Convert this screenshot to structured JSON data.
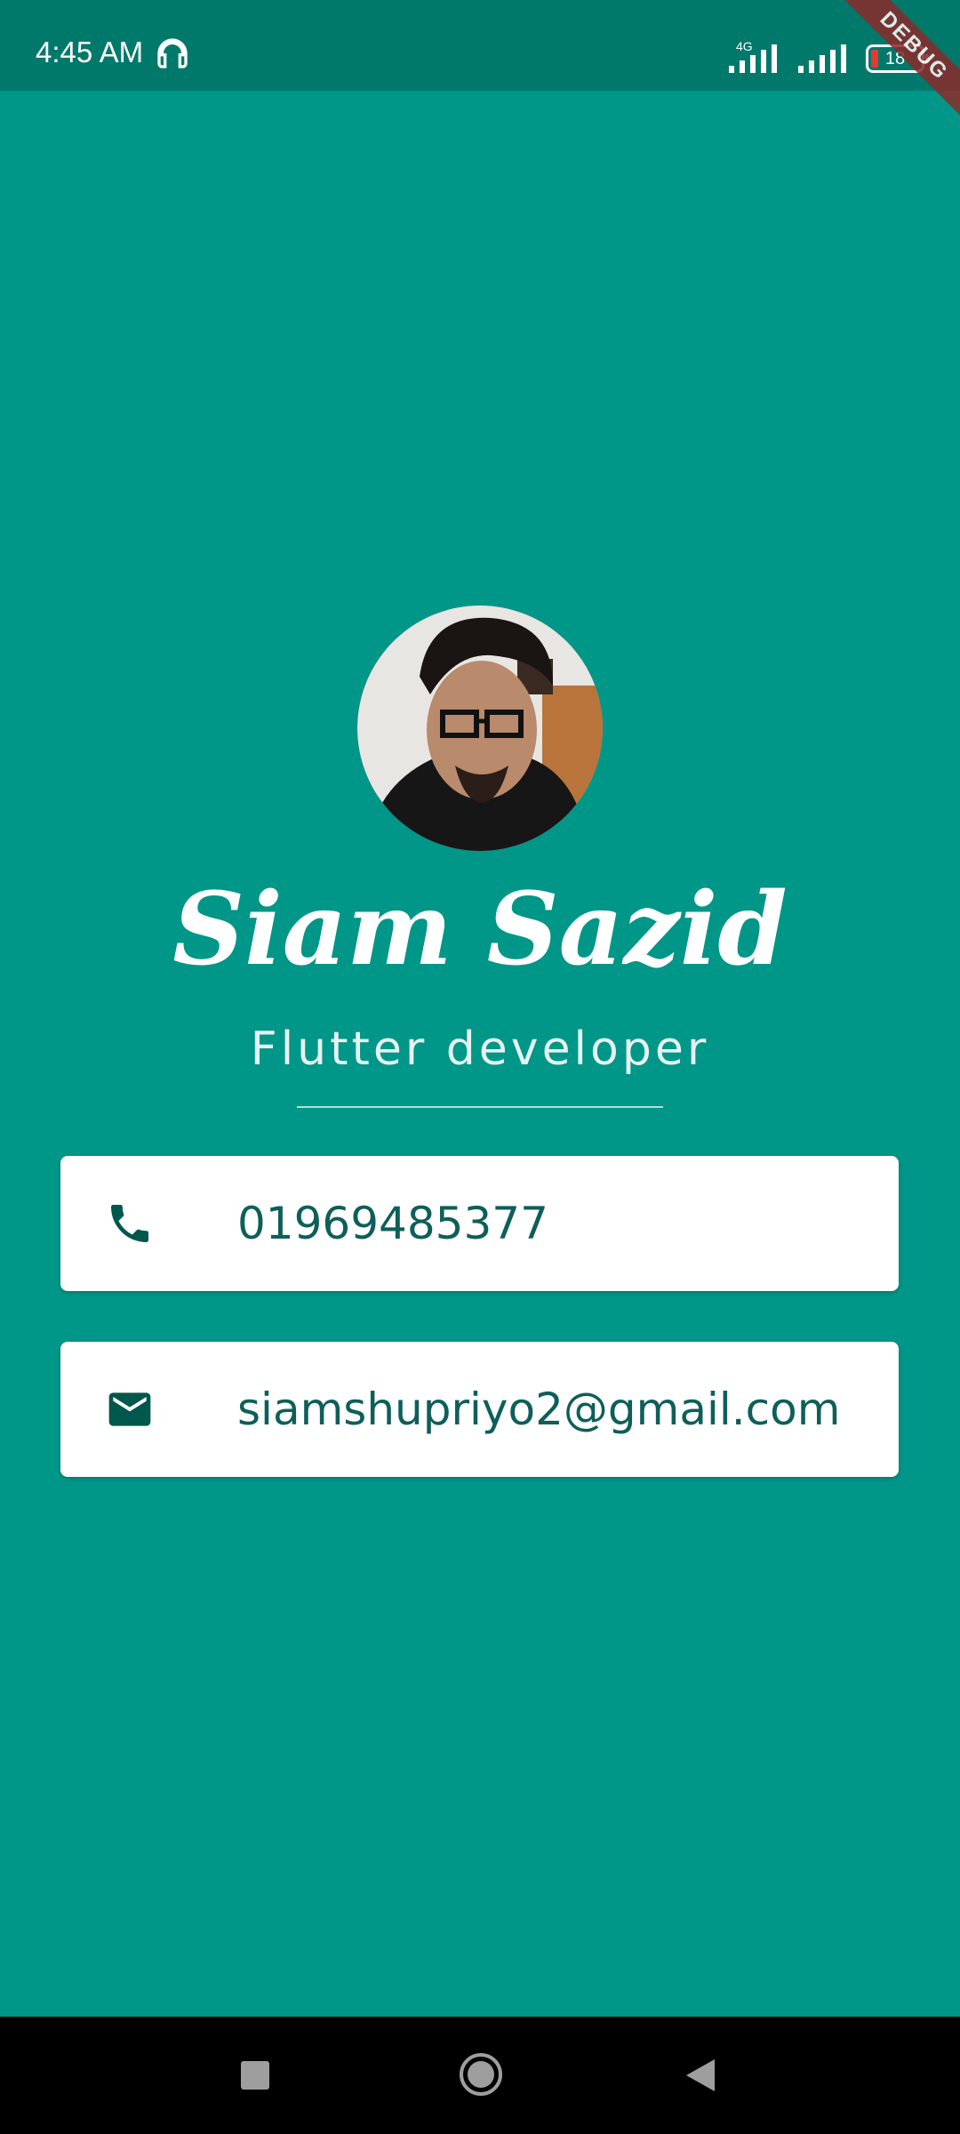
{
  "status_bar": {
    "time": "4:45 AM",
    "network_type": "4G",
    "battery": "18",
    "icons": [
      "headphone-icon",
      "signal-icon",
      "signal-icon",
      "battery-icon"
    ]
  },
  "debug_banner": "DEBUG",
  "profile": {
    "name": "Siam Sazid",
    "title": "Flutter developer"
  },
  "contacts": {
    "phone": {
      "icon": "phone-icon",
      "value": "01969485377"
    },
    "email": {
      "icon": "mail-icon",
      "value": "siamshupriyo2@gmail.com"
    }
  },
  "colors": {
    "background": "#009688",
    "status_bar": "#00796b",
    "card_text": "#0e5f59",
    "icon": "#00574b"
  },
  "nav": {
    "icons": [
      "recent-apps-icon",
      "home-icon",
      "back-icon"
    ]
  }
}
